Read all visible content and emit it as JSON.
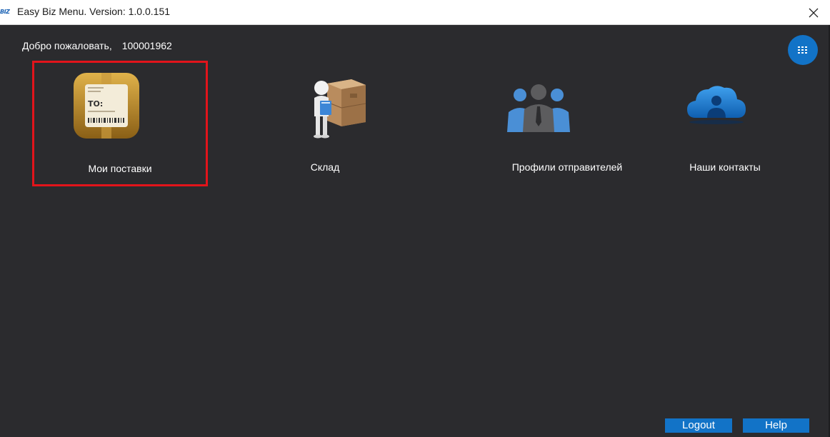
{
  "window": {
    "logo_text": "BIZ",
    "title": "Easy Biz Menu. Version: 1.0.0.151"
  },
  "header": {
    "welcome_text": "Добро пожаловать,",
    "user_id": "100001962"
  },
  "tiles": [
    {
      "label": "Мои поставки",
      "icon": "shipping-label-icon",
      "selected": true
    },
    {
      "label": "Склад",
      "icon": "warehouse-boxes-icon"
    },
    {
      "label": "Профили отправителей",
      "icon": "people-group-icon"
    },
    {
      "label": "Наши контакты",
      "icon": "cloud-contacts-icon"
    }
  ],
  "footer": {
    "logout_label": "Logout",
    "help_label": "Help"
  },
  "colors": {
    "background": "#2b2b2e",
    "accent": "#1273c7",
    "selection_border": "#e2141b"
  }
}
